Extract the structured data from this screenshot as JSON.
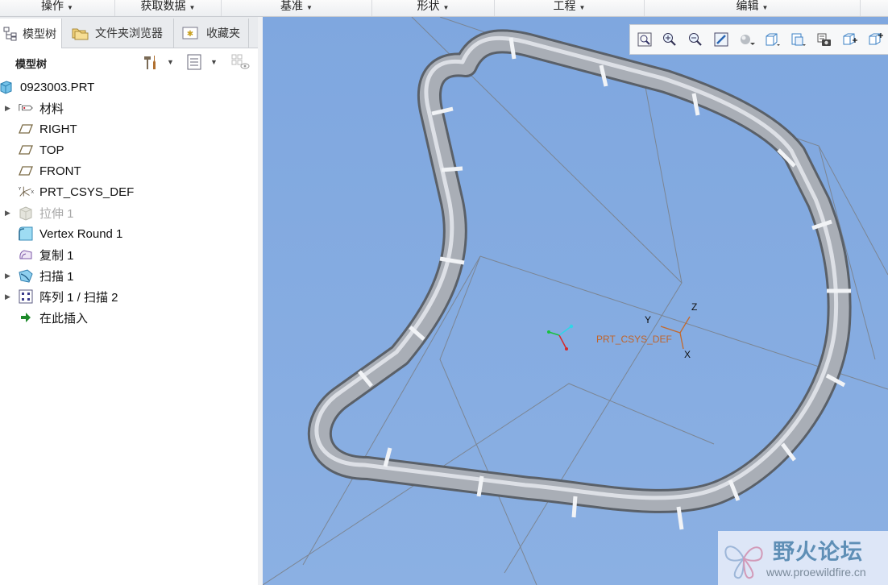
{
  "menu": {
    "items": [
      "操作",
      "获取数据",
      "基准",
      "形状",
      "工程",
      "编辑"
    ]
  },
  "tabs": {
    "model_tree": "模型树",
    "folder_browser": "文件夹浏览器",
    "favorites": "收藏夹"
  },
  "tree_header": {
    "title": "模型树"
  },
  "tree": {
    "items": [
      {
        "label": "0923003.PRT",
        "icon": "part-icon",
        "expandable": false,
        "dim": false
      },
      {
        "label": "材料",
        "icon": "material-icon",
        "expandable": true,
        "dim": false
      },
      {
        "label": "RIGHT",
        "icon": "datum-plane-icon",
        "expandable": false,
        "dim": false
      },
      {
        "label": "TOP",
        "icon": "datum-plane-icon",
        "expandable": false,
        "dim": false
      },
      {
        "label": "FRONT",
        "icon": "datum-plane-icon",
        "expandable": false,
        "dim": false
      },
      {
        "label": "PRT_CSYS_DEF",
        "icon": "csys-icon",
        "expandable": false,
        "dim": false
      },
      {
        "label": "拉伸 1",
        "icon": "extrude-icon",
        "expandable": true,
        "dim": true
      },
      {
        "label": "Vertex Round 1",
        "icon": "vertex-round-icon",
        "expandable": false,
        "dim": false
      },
      {
        "label": "复制 1",
        "icon": "copy-icon",
        "expandable": false,
        "dim": false
      },
      {
        "label": "扫描 1",
        "icon": "sweep-icon",
        "expandable": true,
        "dim": false
      },
      {
        "label": "阵列 1 / 扫描 2",
        "icon": "pattern-icon",
        "expandable": true,
        "dim": false
      },
      {
        "label": "在此插入",
        "icon": "insert-here-arrow-icon",
        "expandable": false,
        "dim": false
      }
    ]
  },
  "viewport": {
    "background_color": "#86ace1",
    "csys_label": "PRT_CSYS_DEF",
    "axis_x": "X",
    "axis_y": "Y",
    "axis_z": "Z",
    "toolbar_icons": [
      "refit-icon",
      "zoom-in-icon",
      "zoom-out-icon",
      "repaint-icon",
      "display-style-icon",
      "saved-views-icon",
      "named-view-list-icon",
      "view-manager-icon",
      "datum-display-icon",
      "spin-center-icon"
    ]
  },
  "watermark": {
    "title": "野火论坛",
    "url": "www.proewildfire.cn"
  }
}
